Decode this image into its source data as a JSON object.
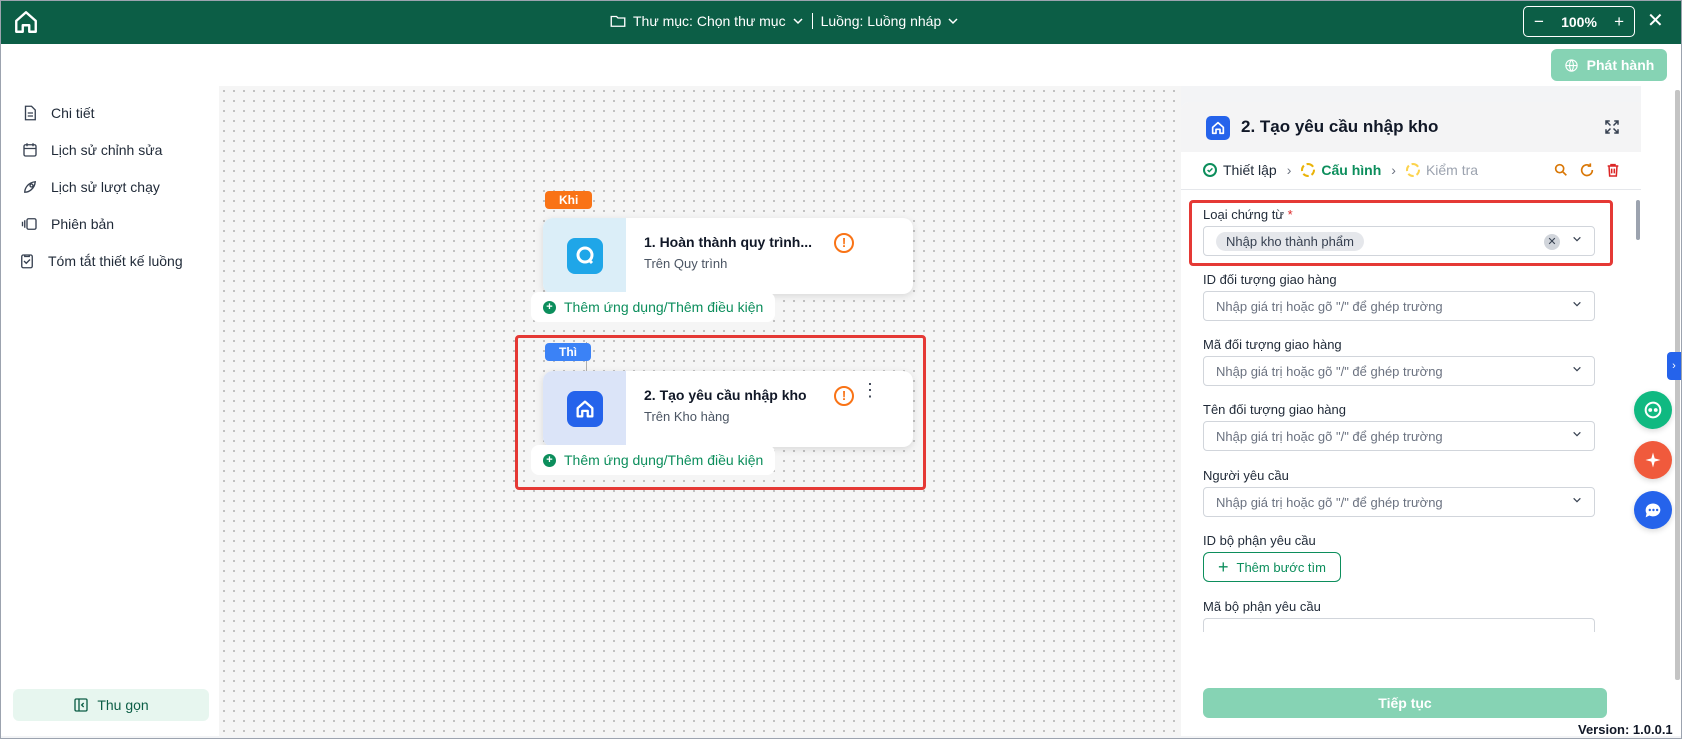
{
  "topbar": {
    "folder": "Thư mục: Chọn thư mục",
    "flow": "Luồng: Luồng nháp",
    "zoom": "100%",
    "zoom_minus": "−",
    "zoom_plus": "+",
    "close": "✕"
  },
  "toolbar": {
    "publish": "Phát hành"
  },
  "sidebar": {
    "items": [
      {
        "label": "Chi tiết",
        "icon": "document-icon"
      },
      {
        "label": "Lịch sử chỉnh sửa",
        "icon": "calendar-edit-icon"
      },
      {
        "label": "Lịch sử lượt chạy",
        "icon": "rocket-icon"
      },
      {
        "label": "Phiên bản",
        "icon": "versions-icon"
      },
      {
        "label": "Tóm tắt thiết kế luồng",
        "icon": "clipboard-icon"
      }
    ],
    "collapse": "Thu gọn"
  },
  "canvas": {
    "trigger": {
      "tag": "Khi",
      "title": "1.  Hoàn thành quy trình...",
      "subtitle": "Trên Quy trình"
    },
    "action": {
      "tag": "Thì",
      "title": "2.  Tạo yêu cầu nhập kho",
      "subtitle": "Trên Kho hàng"
    },
    "add_condition": "Thêm ứng dụng/Thêm điều kiện"
  },
  "panel": {
    "title": "2. Tạo yêu cầu nhập kho",
    "steps": [
      {
        "label": "Thiết lập",
        "state": "done"
      },
      {
        "label": "Cấu hình",
        "state": "active"
      },
      {
        "label": "Kiểm tra",
        "state": "pending"
      }
    ],
    "fields": {
      "doc_type_label": "Loại chứng từ",
      "doc_type_required": "*",
      "doc_type_value": "Nhập kho thành phẩm",
      "placeholder": "Nhập giá trị hoặc gõ \"/\" để ghép trường",
      "delivery_id": "ID đối tượng giao hàng",
      "delivery_code": "Mã đối tượng giao hàng",
      "delivery_name": "Tên đối tượng giao hàng",
      "requester": "Người yêu cầu",
      "dept_id": "ID bộ phận yêu cầu",
      "add_find_step": "Thêm bước tìm",
      "dept_code": "Mã bộ phận yêu cầu"
    },
    "continue": "Tiếp tục"
  },
  "version": "Version: 1.0.0.1",
  "colors": {
    "brand": "#0c5e46",
    "accent_green": "#0c8e5c",
    "warning": "#f97316",
    "highlight_red": "#e53935",
    "tag_khi": "#f97316",
    "tag_thi": "#3b82f6"
  }
}
